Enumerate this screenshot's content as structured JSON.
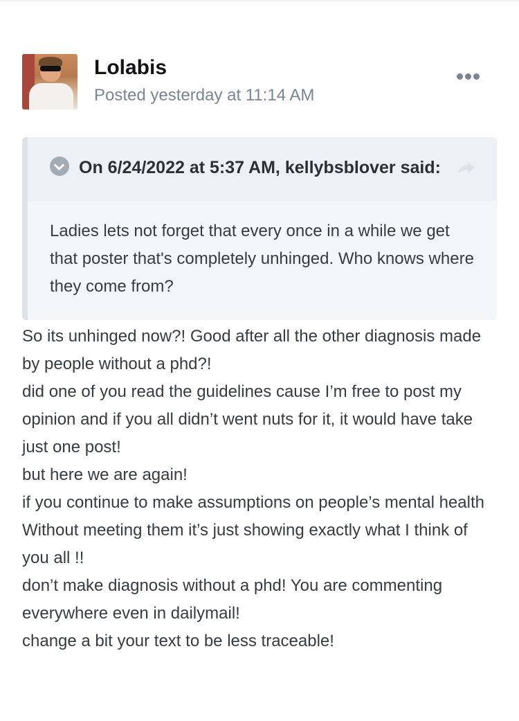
{
  "post": {
    "author": "Lolabis",
    "meta": "Posted yesterday at 11:14 AM",
    "more_icon": "ellipsis-icon"
  },
  "quote": {
    "title": "On 6/24/2022 at 5:37 AM, kellybsblover said:",
    "body": "Ladies lets not forget that every once in a while we get that poster that's completely unhinged. Who knows where they come from?",
    "toggle_icon": "chevron-down-circle-icon",
    "share_icon": "share-arrow-icon"
  },
  "body": {
    "lines": [
      "So its unhinged now?! Good after all the other diagnosis made by people without a phd?!",
      "did one of you read the guidelines cause I’m free to post my opinion and if you all didn’t went nuts for it, it would have take just one post!",
      "but here we are again!",
      "if you continue to make assumptions on people’s mental health Without meeting them it’s just showing exactly what I think of you all !!",
      "don’t make diagnosis without a phd! You are commenting everywhere even in dailymail!",
      "change a bit your text to be less traceable!"
    ]
  },
  "colors": {
    "author": "#111316",
    "meta": "#7a8594",
    "quote_bg": "#f4f7fa",
    "quote_head_bg": "#edf0f4",
    "quote_border": "#dde2e8",
    "text": "#353c41"
  }
}
